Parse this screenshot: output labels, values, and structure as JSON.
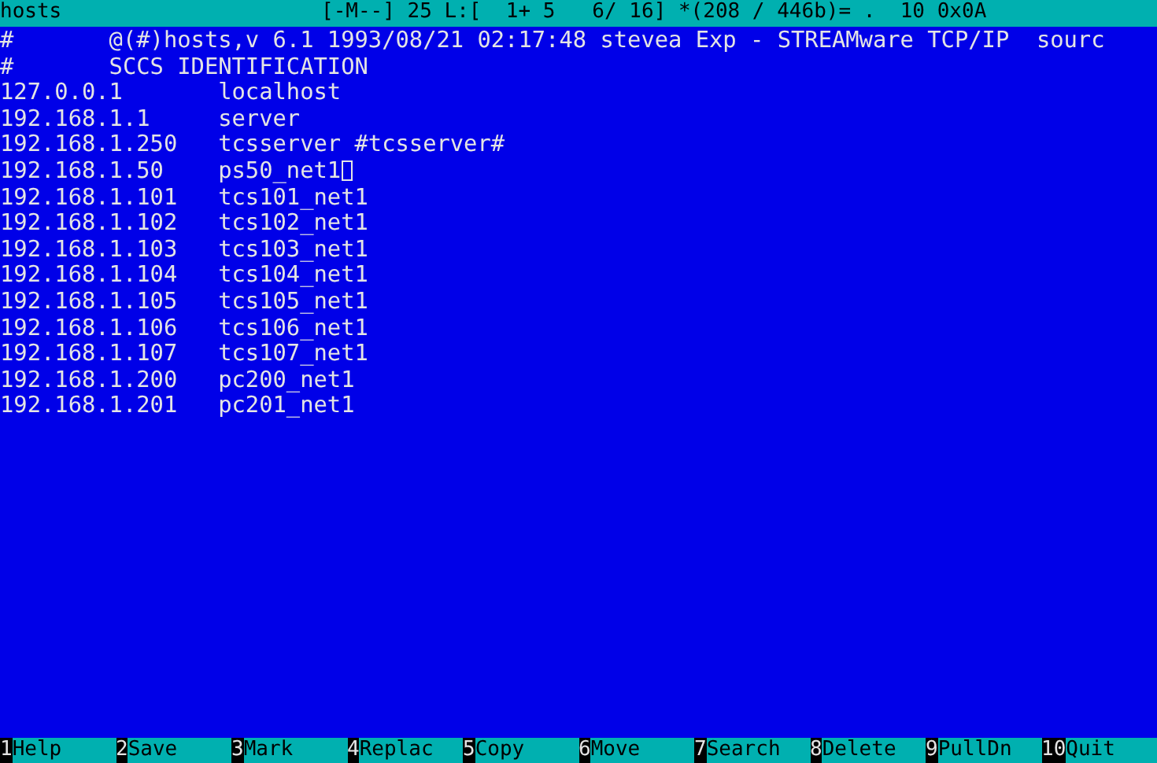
{
  "status_bar": {
    "filename": "hosts",
    "info": "[-M--] 25 L:[  1+ 5   6/ 16] *(208 / 446b)= .  10 0x0A"
  },
  "lines": [
    {
      "column_1": "#",
      "column_2": "@(#)hosts,v 6.1 1993/08/21 02:17:48 stevea Exp - STREAMware TCP/IP  sourc",
      "cursor": false
    },
    {
      "column_1": "#",
      "column_2": "SCCS IDENTIFICATION",
      "cursor": false
    },
    {
      "column_1": "127.0.0.1",
      "column_2": "localhost",
      "cursor": false
    },
    {
      "column_1": "192.168.1.1",
      "column_2": "server",
      "cursor": false
    },
    {
      "column_1": "192.168.1.250",
      "column_2": "tcsserver #tcsserver#",
      "cursor": false
    },
    {
      "column_1": "192.168.1.50",
      "column_2": "ps50_net1",
      "cursor": true
    },
    {
      "column_1": "192.168.1.101",
      "column_2": "tcs101_net1",
      "cursor": false
    },
    {
      "column_1": "192.168.1.102",
      "column_2": "tcs102_net1",
      "cursor": false
    },
    {
      "column_1": "192.168.1.103",
      "column_2": "tcs103_net1",
      "cursor": false
    },
    {
      "column_1": "192.168.1.104",
      "column_2": "tcs104_net1",
      "cursor": false
    },
    {
      "column_1": "192.168.1.105",
      "column_2": "tcs105_net1",
      "cursor": false
    },
    {
      "column_1": "192.168.1.106",
      "column_2": "tcs106_net1",
      "cursor": false
    },
    {
      "column_1": "192.168.1.107",
      "column_2": "tcs107_net1",
      "cursor": false
    },
    {
      "column_1": "192.168.1.200",
      "column_2": "pc200_net1",
      "cursor": false
    },
    {
      "column_1": "192.168.1.201",
      "column_2": "pc201_net1",
      "cursor": false
    }
  ],
  "function_keys": [
    {
      "number": "1",
      "label": "Help"
    },
    {
      "number": "2",
      "label": "Save"
    },
    {
      "number": "3",
      "label": "Mark"
    },
    {
      "number": "4",
      "label": "Replac"
    },
    {
      "number": "5",
      "label": "Copy"
    },
    {
      "number": "6",
      "label": "Move"
    },
    {
      "number": "7",
      "label": "Search"
    },
    {
      "number": "8",
      "label": "Delete"
    },
    {
      "number": "9",
      "label": "PullDn"
    },
    {
      "number": "10",
      "label": "Quit"
    }
  ]
}
